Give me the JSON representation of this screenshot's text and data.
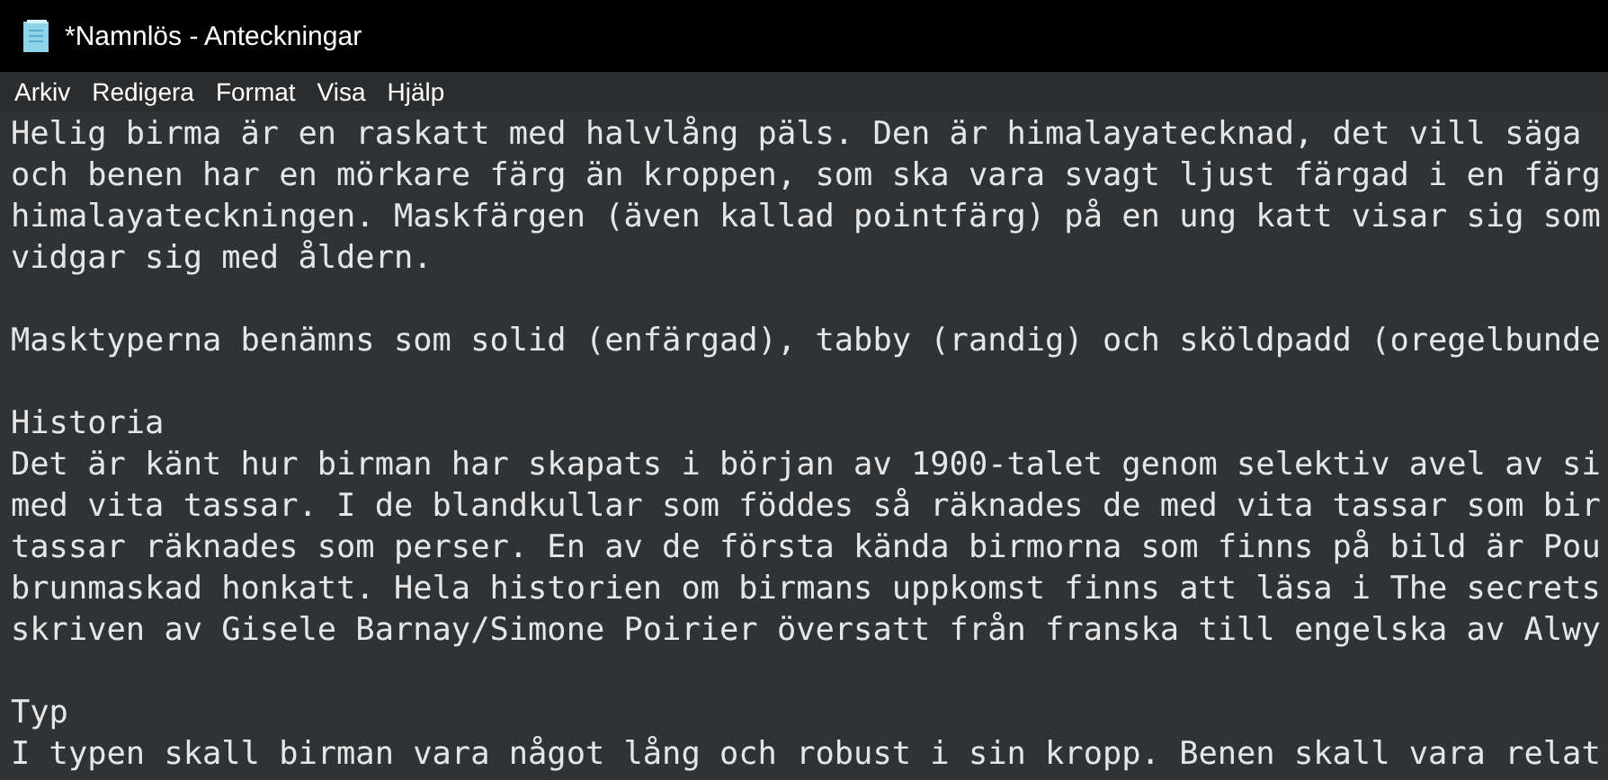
{
  "window": {
    "title": "*Namnlös - Anteckningar"
  },
  "menu": [
    "Arkiv",
    "Redigera",
    "Format",
    "Visa",
    "Hjälp"
  ],
  "document": {
    "paragraphs": [
      [
        "Helig birma är en raskatt med halvlång päls. Den är himalayatecknad, det vill säga",
        "och benen har en mörkare färg än kroppen, som ska vara svagt ljust färgad i en färg",
        "himalayateckningen. Maskfärgen (även kallad pointfärg) på en ung katt visar sig som",
        "vidgar sig med åldern."
      ],
      [
        "Masktyperna benämns som solid (enfärgad), tabby (randig) och sköldpadd (oregelbunde"
      ],
      [
        "Historia",
        "Det är känt hur birman har skapats i början av 1900-talet genom selektiv avel av si",
        "med vita tassar. I de blandkullar som föddes så räknades de med vita tassar som bir",
        "tassar räknades som perser. En av de första kända birmorna som finns på bild är Pou",
        "brunmaskad honkatt. Hela historien om birmans uppkomst finns att läsa i The secrets",
        "skriven av Gisele Barnay/Simone Poirier översatt från franska till engelska av Alwy"
      ],
      [
        "Typ",
        "I typen skall birman vara något lång och robust i sin kropp. Benen skall vara relat"
      ]
    ]
  }
}
